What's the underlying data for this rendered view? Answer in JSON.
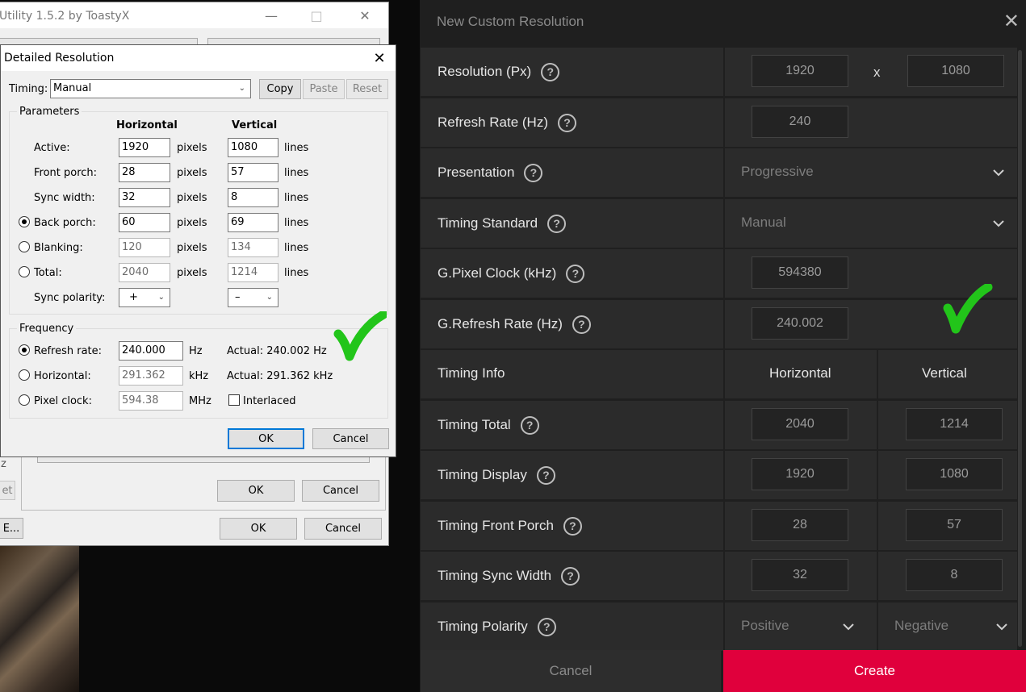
{
  "colors": {
    "accent_red": "#e0003c",
    "check_green": "#22c51a",
    "win_blue": "#0078d7"
  },
  "back_window": {
    "title": "Utility 1.5.2 by ToastyX",
    "ok": "OK",
    "cancel": "Cancel",
    "ok2": "OK",
    "cancel2": "Cancel",
    "left_frag_1": "z",
    "left_frag_2": "et",
    "left_frag_3": "E..."
  },
  "dialog": {
    "title": "Detailed Resolution",
    "timing_label": "Timing:",
    "timing_value": "Manual",
    "copy": "Copy",
    "paste": "Paste",
    "reset": "Reset",
    "parameters_label": "Parameters",
    "horizontal_header": "Horizontal",
    "vertical_header": "Vertical",
    "rows": [
      {
        "label": "Active:",
        "h": "1920",
        "h_unit": "pixels",
        "v": "1080",
        "v_unit": "lines"
      },
      {
        "label": "Front porch:",
        "h": "28",
        "h_unit": "pixels",
        "v": "57",
        "v_unit": "lines"
      },
      {
        "label": "Sync width:",
        "h": "32",
        "h_unit": "pixels",
        "v": "8",
        "v_unit": "lines"
      },
      {
        "label": "Back porch:",
        "h": "60",
        "h_unit": "pixels",
        "v": "69",
        "v_unit": "lines"
      },
      {
        "label": "Blanking:",
        "h": "120",
        "h_unit": "pixels",
        "v": "134",
        "v_unit": "lines"
      },
      {
        "label": "Total:",
        "h": "2040",
        "h_unit": "pixels",
        "v": "1214",
        "v_unit": "lines"
      }
    ],
    "sync_polarity_label": "Sync polarity:",
    "sync_h": "+",
    "sync_v": "–",
    "frequency_label": "Frequency",
    "refresh_label": "Refresh rate:",
    "refresh_value": "240.000",
    "refresh_unit": "Hz",
    "refresh_actual": "Actual: 240.002 Hz",
    "horizontal_label": "Horizontal:",
    "horizontal_value": "291.362",
    "horizontal_unit": "kHz",
    "horizontal_actual": "Actual: 291.362 kHz",
    "pixel_label": "Pixel clock:",
    "pixel_value": "594.38",
    "pixel_unit": "MHz",
    "interlaced_label": "Interlaced",
    "ok": "OK",
    "cancel": "Cancel"
  },
  "panel": {
    "title": "New Custom Resolution",
    "x_sep": "x",
    "rows": [
      {
        "label": "Resolution (Px)",
        "v1": "1920",
        "v2": "1080"
      },
      {
        "label": "Refresh Rate (Hz)",
        "v1": "240"
      },
      {
        "label": "Presentation",
        "select": "Progressive"
      },
      {
        "label": "Timing Standard",
        "select": "Manual"
      },
      {
        "label": "G.Pixel Clock (kHz)",
        "v1": "594380"
      },
      {
        "label": "G.Refresh Rate (Hz)",
        "v1": "240.002"
      },
      {
        "label": "Timing Info",
        "h1": "Horizontal",
        "h2": "Vertical"
      },
      {
        "label": "Timing Total",
        "v1": "2040",
        "v2": "1214"
      },
      {
        "label": "Timing Display",
        "v1": "1920",
        "v2": "1080"
      },
      {
        "label": "Timing Front Porch",
        "v1": "28",
        "v2": "57"
      },
      {
        "label": "Timing Sync Width",
        "v1": "32",
        "v2": "8"
      },
      {
        "label": "Timing Polarity",
        "s1": "Positive",
        "s2": "Negative"
      }
    ],
    "cancel": "Cancel",
    "create": "Create"
  }
}
